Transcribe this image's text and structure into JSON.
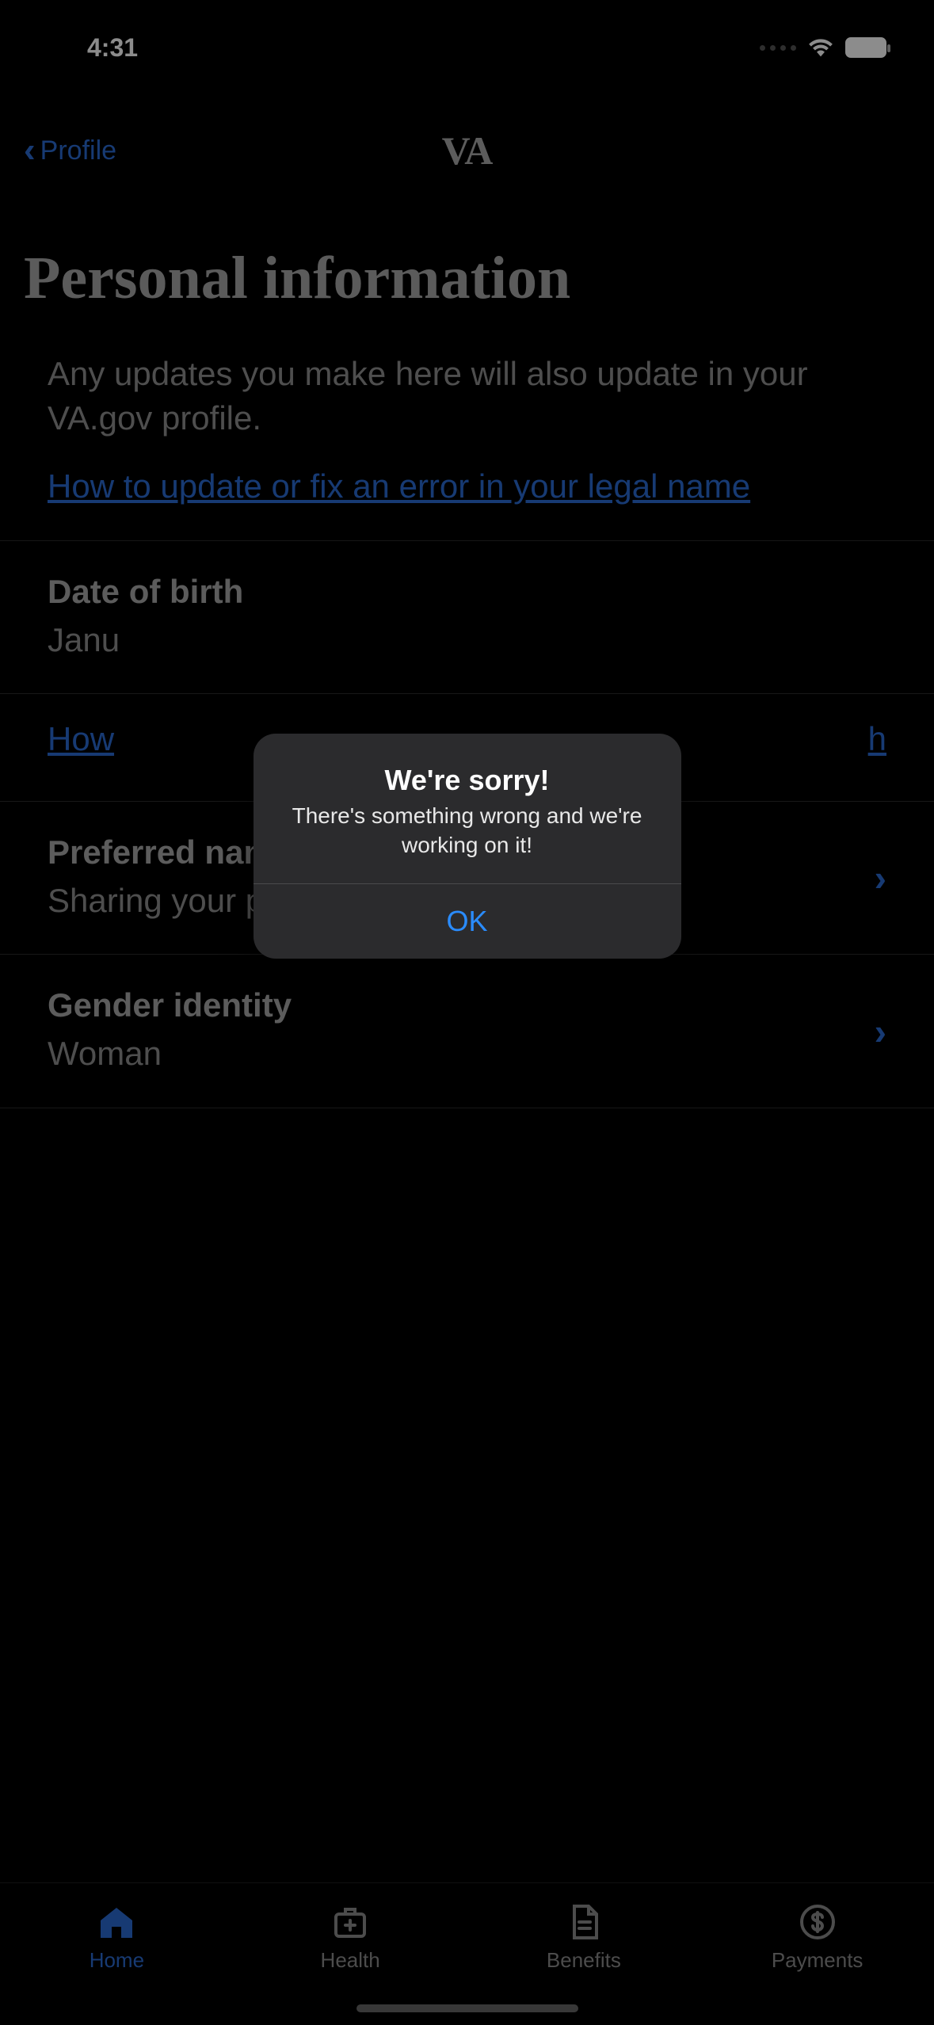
{
  "status": {
    "time": "4:31"
  },
  "nav": {
    "back_label": "Profile",
    "title": "VA"
  },
  "page": {
    "title": "Personal information",
    "intro_text": "Any updates you make here will also update in your VA.gov profile.",
    "help_link": "How to update or fix an error in your legal name"
  },
  "rows": {
    "dob": {
      "label": "Date of birth",
      "value_partial": "Janu"
    },
    "dob_help_partial_left": "How",
    "dob_help_partial_right": "h",
    "preferred_name": {
      "label": "Preferred name",
      "value": "Sharing your preferred name is optional."
    },
    "gender": {
      "label": "Gender identity",
      "value": "Woman"
    }
  },
  "tabs": {
    "home": "Home",
    "health": "Health",
    "benefits": "Benefits",
    "payments": "Payments"
  },
  "alert": {
    "title": "We're sorry!",
    "message": "There's something wrong and we're working on it!",
    "ok": "OK"
  }
}
